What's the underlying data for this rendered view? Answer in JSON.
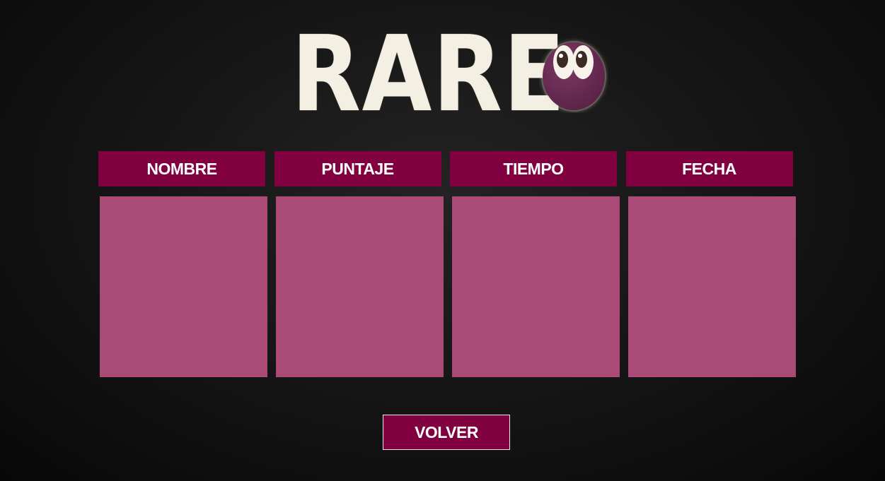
{
  "logo": {
    "title": "RARE",
    "mascot_icon": "purple-egg-with-eyes"
  },
  "table": {
    "headers": [
      "NOMBRE",
      "PUNTAJE",
      "TIEMPO",
      "FECHA"
    ],
    "rows": []
  },
  "buttons": {
    "back_label": "VOLVER"
  },
  "colors": {
    "header_bg": "#800040",
    "panel_bg": "#aa4b77",
    "background": "#141414",
    "logo_text": "#f3efe2",
    "mascot": "#6e2c55"
  }
}
